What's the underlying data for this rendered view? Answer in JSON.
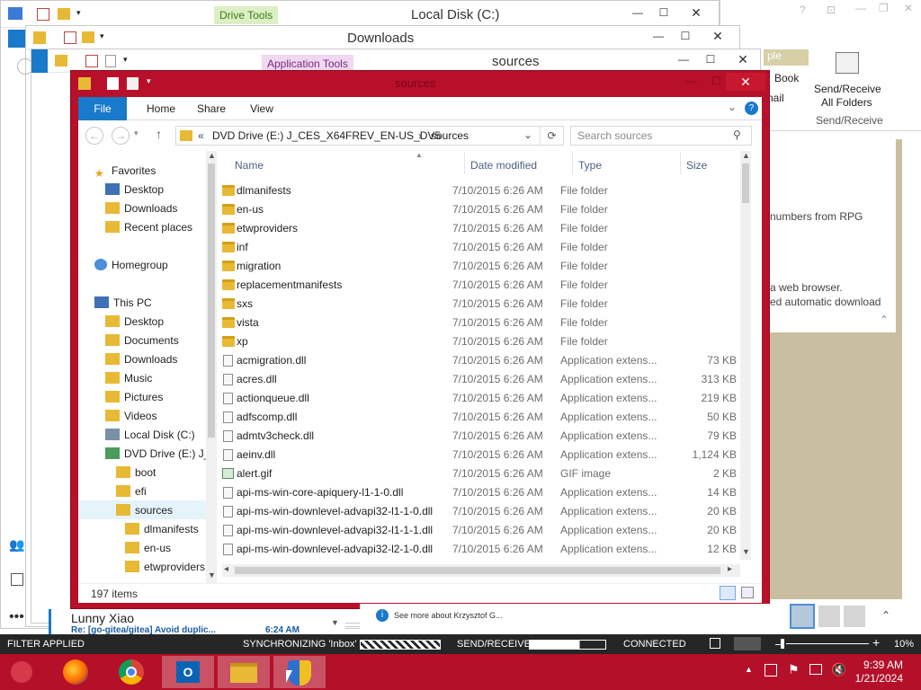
{
  "windows": {
    "local_disk": {
      "title": "Local Disk (C:)",
      "context_tab": "Drive Tools"
    },
    "downloads": {
      "title": "Downloads"
    },
    "sources_bg": {
      "title": "sources",
      "context_tab": "Application Tools"
    },
    "main": {
      "title": "sources"
    }
  },
  "outlook_ribbon": {
    "send_receive_line1": "Send/Receive",
    "send_receive_line2": "All Folders",
    "group_label": "Send/Receive",
    "book_label": "Book",
    "mail_label": "nail",
    "sample_label": "ple"
  },
  "ribbon": {
    "tabs": [
      "File",
      "Home",
      "Share",
      "View"
    ]
  },
  "address": {
    "prefix": "«",
    "crumb1": "DVD Drive (E:) J_CES_X64FREV_EN-US_DV5",
    "sep": "›",
    "crumb2": "sources",
    "search_placeholder": "Search sources"
  },
  "nav": {
    "favorites": "Favorites",
    "fav_items": [
      "Desktop",
      "Downloads",
      "Recent places"
    ],
    "homegroup": "Homegroup",
    "this_pc": "This PC",
    "pc_items": [
      "Desktop",
      "Documents",
      "Downloads",
      "Music",
      "Pictures",
      "Videos",
      "Local Disk (C:)",
      "DVD Drive (E:) J_C"
    ],
    "dvd_items": [
      "boot",
      "efi",
      "sources"
    ],
    "sources_items": [
      "dlmanifests",
      "en-us",
      "etwproviders"
    ]
  },
  "columns": {
    "name": "Name",
    "date": "Date modified",
    "type": "Type",
    "size": "Size"
  },
  "files": [
    {
      "name": "dlmanifests",
      "date": "7/10/2015 6:26 AM",
      "type": "File folder",
      "size": "",
      "icon": "folder"
    },
    {
      "name": "en-us",
      "date": "7/10/2015 6:26 AM",
      "type": "File folder",
      "size": "",
      "icon": "folder"
    },
    {
      "name": "etwproviders",
      "date": "7/10/2015 6:26 AM",
      "type": "File folder",
      "size": "",
      "icon": "folder"
    },
    {
      "name": "inf",
      "date": "7/10/2015 6:26 AM",
      "type": "File folder",
      "size": "",
      "icon": "folder"
    },
    {
      "name": "migration",
      "date": "7/10/2015 6:26 AM",
      "type": "File folder",
      "size": "",
      "icon": "folder"
    },
    {
      "name": "replacementmanifests",
      "date": "7/10/2015 6:26 AM",
      "type": "File folder",
      "size": "",
      "icon": "folder"
    },
    {
      "name": "sxs",
      "date": "7/10/2015 6:26 AM",
      "type": "File folder",
      "size": "",
      "icon": "folder"
    },
    {
      "name": "vista",
      "date": "7/10/2015 6:26 AM",
      "type": "File folder",
      "size": "",
      "icon": "folder"
    },
    {
      "name": "xp",
      "date": "7/10/2015 6:26 AM",
      "type": "File folder",
      "size": "",
      "icon": "folder"
    },
    {
      "name": "acmigration.dll",
      "date": "7/10/2015 6:26 AM",
      "type": "Application extens...",
      "size": "73 KB",
      "icon": "dll"
    },
    {
      "name": "acres.dll",
      "date": "7/10/2015 6:26 AM",
      "type": "Application extens...",
      "size": "313 KB",
      "icon": "dll"
    },
    {
      "name": "actionqueue.dll",
      "date": "7/10/2015 6:26 AM",
      "type": "Application extens...",
      "size": "219 KB",
      "icon": "dll"
    },
    {
      "name": "adfscomp.dll",
      "date": "7/10/2015 6:26 AM",
      "type": "Application extens...",
      "size": "50 KB",
      "icon": "dll"
    },
    {
      "name": "admtv3check.dll",
      "date": "7/10/2015 6:26 AM",
      "type": "Application extens...",
      "size": "79 KB",
      "icon": "dll"
    },
    {
      "name": "aeinv.dll",
      "date": "7/10/2015 6:26 AM",
      "type": "Application extens...",
      "size": "1,124 KB",
      "icon": "dll"
    },
    {
      "name": "alert.gif",
      "date": "7/10/2015 6:26 AM",
      "type": "GIF image",
      "size": "2 KB",
      "icon": "gif"
    },
    {
      "name": "api-ms-win-core-apiquery-l1-1-0.dll",
      "date": "7/10/2015 6:26 AM",
      "type": "Application extens...",
      "size": "14 KB",
      "icon": "dll"
    },
    {
      "name": "api-ms-win-downlevel-advapi32-l1-1-0.dll",
      "date": "7/10/2015 6:26 AM",
      "type": "Application extens...",
      "size": "20 KB",
      "icon": "dll"
    },
    {
      "name": "api-ms-win-downlevel-advapi32-l1-1-1.dll",
      "date": "7/10/2015 6:26 AM",
      "type": "Application extens...",
      "size": "20 KB",
      "icon": "dll"
    },
    {
      "name": "api-ms-win-downlevel-advapi32-l2-1-0.dll",
      "date": "7/10/2015 6:26 AM",
      "type": "Application extens...",
      "size": "12 KB",
      "icon": "dll"
    }
  ],
  "status": {
    "items": "197 items"
  },
  "outlook": {
    "snippet1": "numbers from RPG",
    "snippet2": "a web browser.",
    "snippet3": "ed automatic download",
    "mail_sender": "Lunny Xiao",
    "mail_subject": "Re: [go-gitea/gitea] Avoid duplic...",
    "mail_time": "6:24 AM",
    "people_text": "See more about Krzysztof G..."
  },
  "outlook_status": {
    "filter": "FILTER APPLIED",
    "sync": "SYNCHRONIZING  'Inbox'",
    "send_receive": "SEND/RECEIVE",
    "connected": "CONNECTED",
    "zoom": "10%"
  },
  "taskbar": {
    "time": "9:39 AM",
    "date": "1/21/2024"
  },
  "colors": {
    "accent": "#b8102a",
    "file_tab": "#1979ca",
    "folder": "#e7b935"
  }
}
